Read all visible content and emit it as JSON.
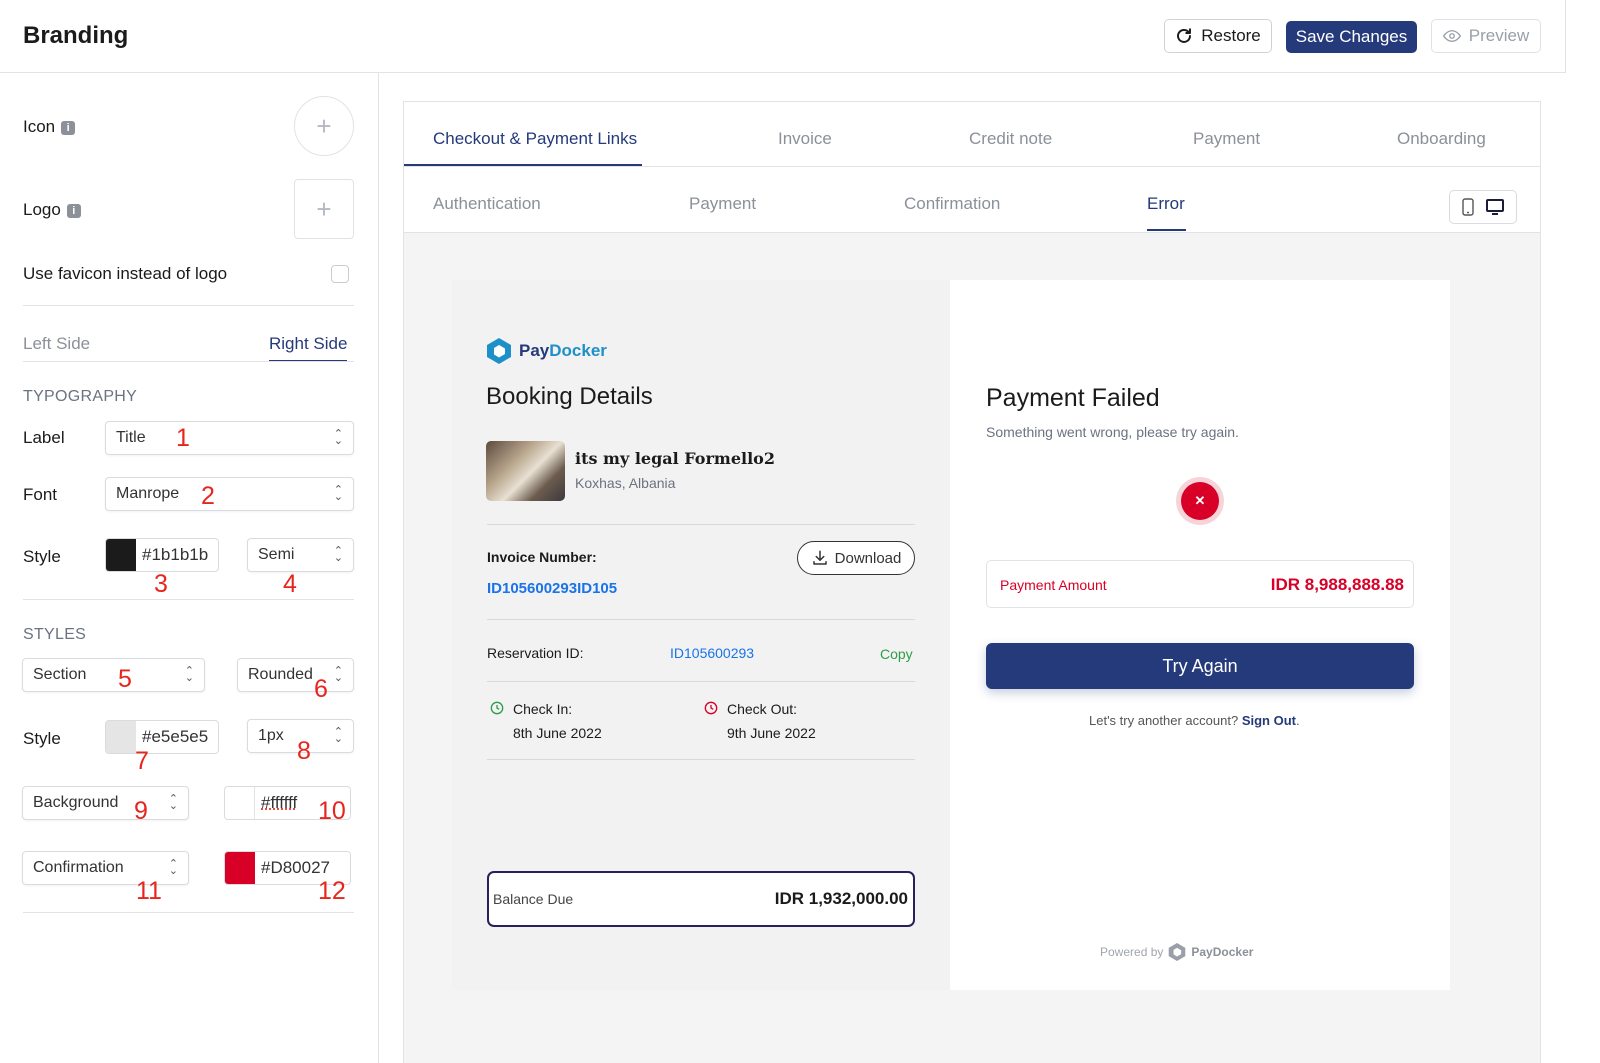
{
  "header": {
    "title": "Branding",
    "restore_label": "Restore",
    "save_label": "Save Changes",
    "preview_label": "Preview"
  },
  "sidebar": {
    "icon_label": "Icon",
    "logo_label": "Logo",
    "favicon_label": "Use favicon instead of logo",
    "side_tabs": [
      "Left Side",
      "Right Side"
    ],
    "typography_heading": "TYPOGRAPHY",
    "label_label": "Label",
    "label_value": "Title",
    "font_label": "Font",
    "font_value": "Manrope",
    "style_label": "Style",
    "text_color": "#1b1b1b",
    "weight_value": "Semi",
    "styles_heading": "STYLES",
    "section_value": "Section",
    "shape_value": "Rounded",
    "style2_label": "Style",
    "border_color": "#e5e5e5",
    "border_width": "1px",
    "background_value": "Background",
    "background_color": "#ffffff",
    "confirmation_value": "Confirmation",
    "confirmation_color": "#D80027",
    "markers": [
      "1",
      "2",
      "3",
      "4",
      "5",
      "6",
      "7",
      "8",
      "9",
      "10",
      "11",
      "12"
    ]
  },
  "tabs": [
    "Checkout & Payment Links",
    "Invoice",
    "Credit note",
    "Payment",
    "Onboarding"
  ],
  "subtabs": [
    "Authentication",
    "Payment",
    "Confirmation",
    "Error"
  ],
  "preview": {
    "brand_pay": "Pay",
    "brand_docker": "Docker",
    "booking_title": "Booking Details",
    "property_name": "its my legal Formello2",
    "property_location": "Koxhas, Albania",
    "invoice_label": "Invoice Number:",
    "invoice_value": "ID105600293ID105",
    "download_label": "Download",
    "reservation_label": "Reservation ID:",
    "reservation_value": "ID105600293",
    "copy_label": "Copy",
    "checkin_label": "Check In:",
    "checkin_value": "8th June 2022",
    "checkout_label": "Check Out:",
    "checkout_value": "9th June 2022",
    "balance_label": "Balance Due",
    "balance_value": "IDR 1,932,000.00",
    "failed_title": "Payment Failed",
    "failed_subtitle": "Something went wrong, please try again.",
    "amount_label": "Payment Amount",
    "amount_value": "IDR 8,988,888.88",
    "try_again": "Try Again",
    "another_account": "Let's try another account?",
    "sign_out": "Sign Out",
    "period": ".",
    "powered_by": "Powered by",
    "powered_brand": "PayDocker"
  },
  "colors": {
    "accent": "#243a7a",
    "error": "#d80027",
    "link": "#1a73e8",
    "green": "#2e9d48"
  }
}
